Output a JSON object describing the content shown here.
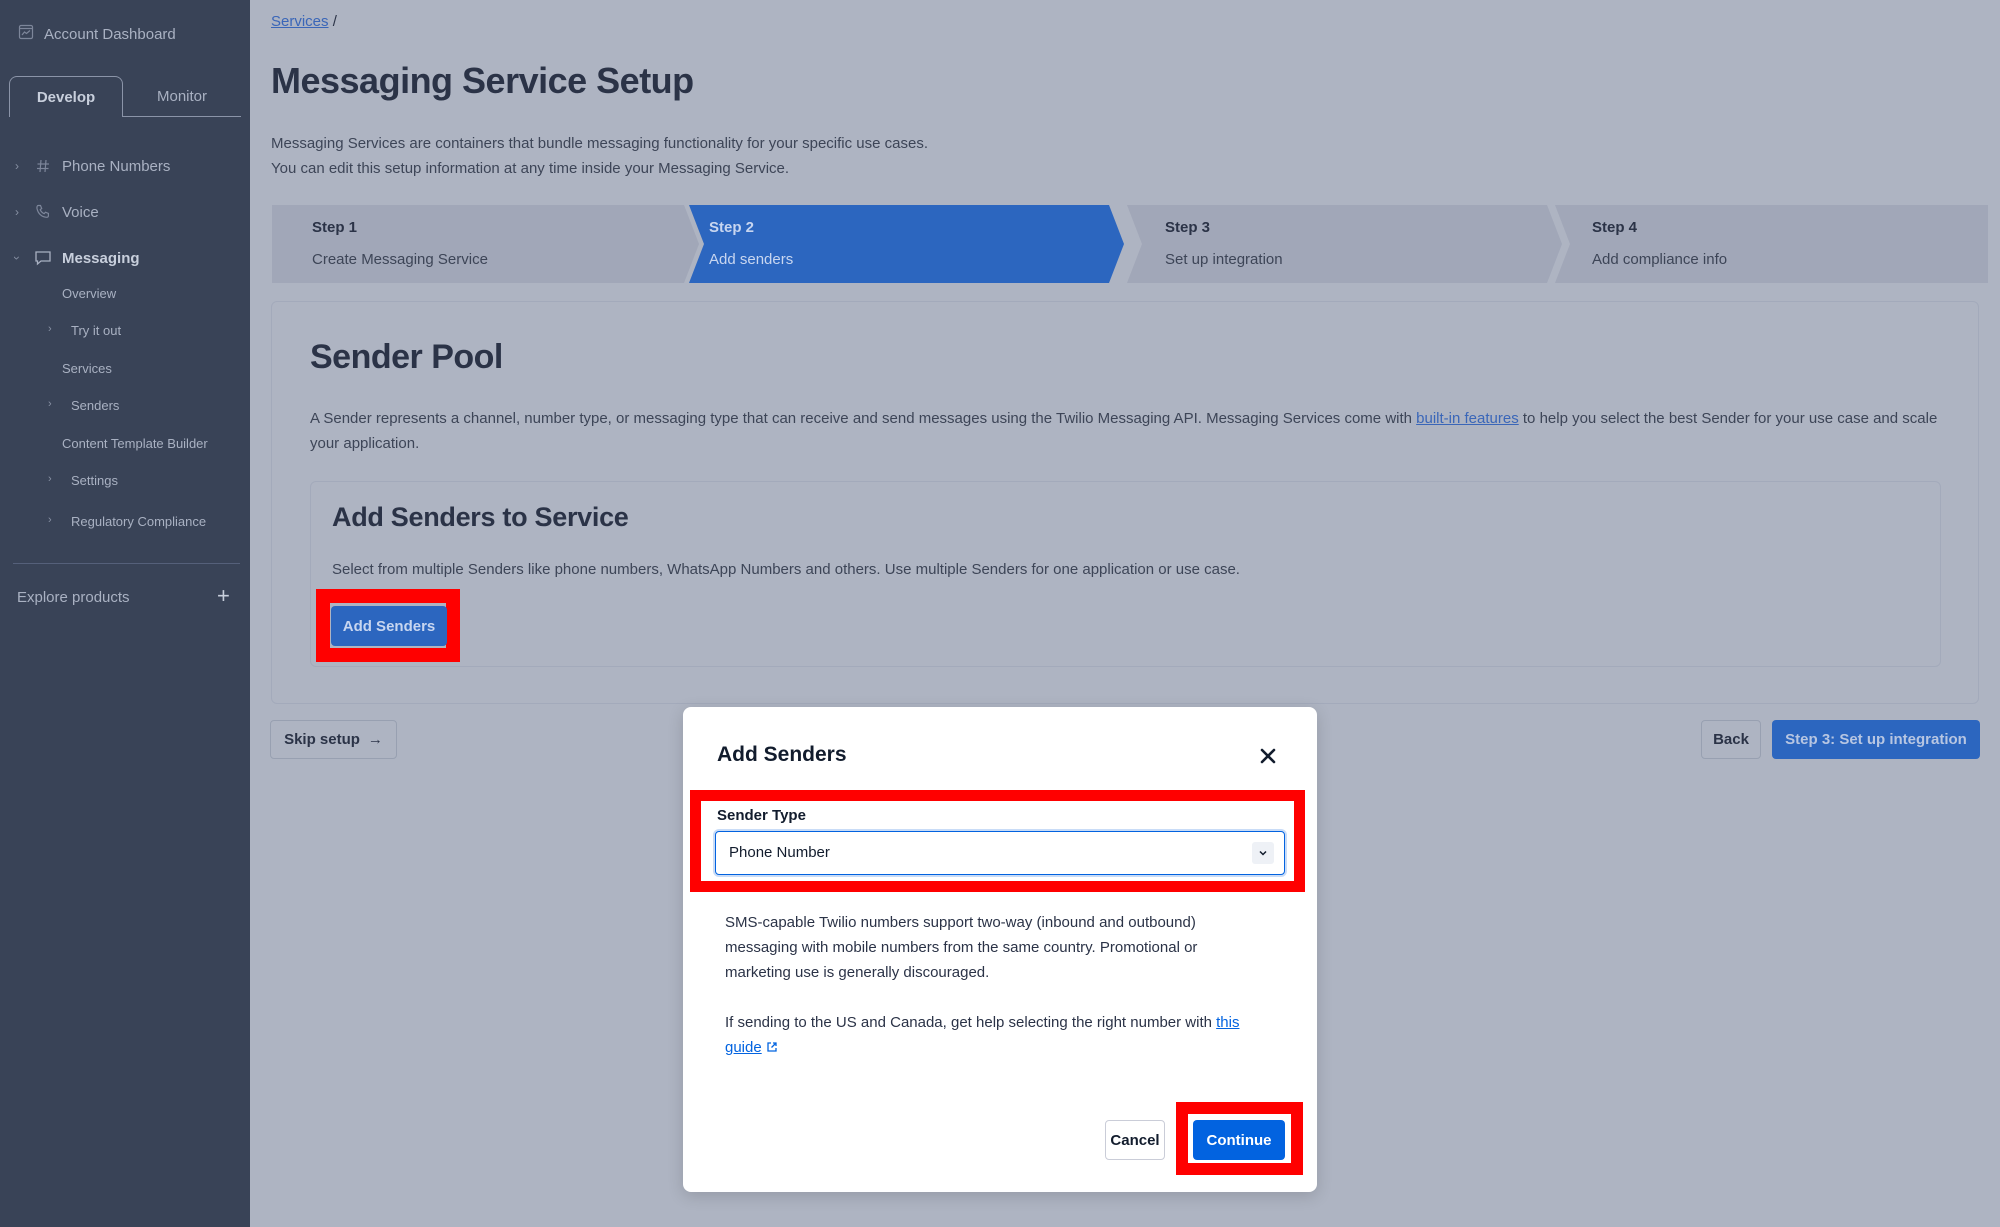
{
  "sidebar": {
    "dashboard_label": "Account Dashboard",
    "tabs": [
      {
        "label": "Develop",
        "active": true
      },
      {
        "label": "Monitor",
        "active": false
      }
    ],
    "nav": [
      {
        "label": "Phone Numbers",
        "icon": "hash-icon",
        "expanded": false
      },
      {
        "label": "Voice",
        "icon": "phone-icon",
        "expanded": false
      },
      {
        "label": "Messaging",
        "icon": "chat-icon",
        "expanded": true
      }
    ],
    "messaging_children": [
      {
        "label": "Overview",
        "has_chevron": false
      },
      {
        "label": "Try it out",
        "has_chevron": true
      },
      {
        "label": "Services",
        "has_chevron": false
      },
      {
        "label": "Senders",
        "has_chevron": true
      },
      {
        "label": "Content Template Builder",
        "has_chevron": false
      },
      {
        "label": "Settings",
        "has_chevron": true
      },
      {
        "label": "Regulatory Compliance",
        "has_chevron": true
      }
    ],
    "explore_label": "Explore products",
    "explore_icon": "+"
  },
  "breadcrumb": {
    "link": "Services",
    "separator": "/"
  },
  "page": {
    "title": "Messaging Service Setup",
    "description_line1": "Messaging Services are containers that bundle messaging functionality for your specific use cases.",
    "description_line2": "You can edit this setup information at any time inside your Messaging Service."
  },
  "stepper": {
    "steps": [
      {
        "title": "Step 1",
        "subtitle": "Create Messaging Service",
        "active": false
      },
      {
        "title": "Step 2",
        "subtitle": "Add senders",
        "active": true
      },
      {
        "title": "Step 3",
        "subtitle": "Set up integration",
        "active": false
      },
      {
        "title": "Step 4",
        "subtitle": "Add compliance info",
        "active": false
      }
    ],
    "colors": {
      "active": "#2c66bf",
      "inactive": "#a1a7b8"
    }
  },
  "sender_pool": {
    "title": "Sender Pool",
    "description_before": "A Sender represents a channel, number type, or messaging type that can receive and send messages using the Twilio Messaging API. Messaging Services come with ",
    "description_link": "built-in features",
    "description_after": " to help you select the best Sender for your use case and scale your application.",
    "inner": {
      "title": "Add Senders to Service",
      "description": "Select from multiple Senders like phone numbers, WhatsApp Numbers and others. Use multiple Senders for one application or use case.",
      "button": "Add Senders"
    }
  },
  "footer": {
    "skip": "Skip setup",
    "skip_icon": "→",
    "back": "Back",
    "next": "Step 3: Set up integration"
  },
  "modal": {
    "title": "Add Senders",
    "close_icon": "×",
    "field_label": "Sender Type",
    "field_value": "Phone Number",
    "body_p1": "SMS-capable Twilio numbers support two-way (inbound and outbound) messaging with mobile numbers from the same country. Promotional or marketing use is generally discouraged.",
    "body_p2_before": "If sending to the US and Canada, get help selecting the right number with ",
    "body_p2_link": "this guide",
    "cancel": "Cancel",
    "continue": "Continue"
  },
  "annotations": {
    "highlight_color": "#ff0000"
  }
}
